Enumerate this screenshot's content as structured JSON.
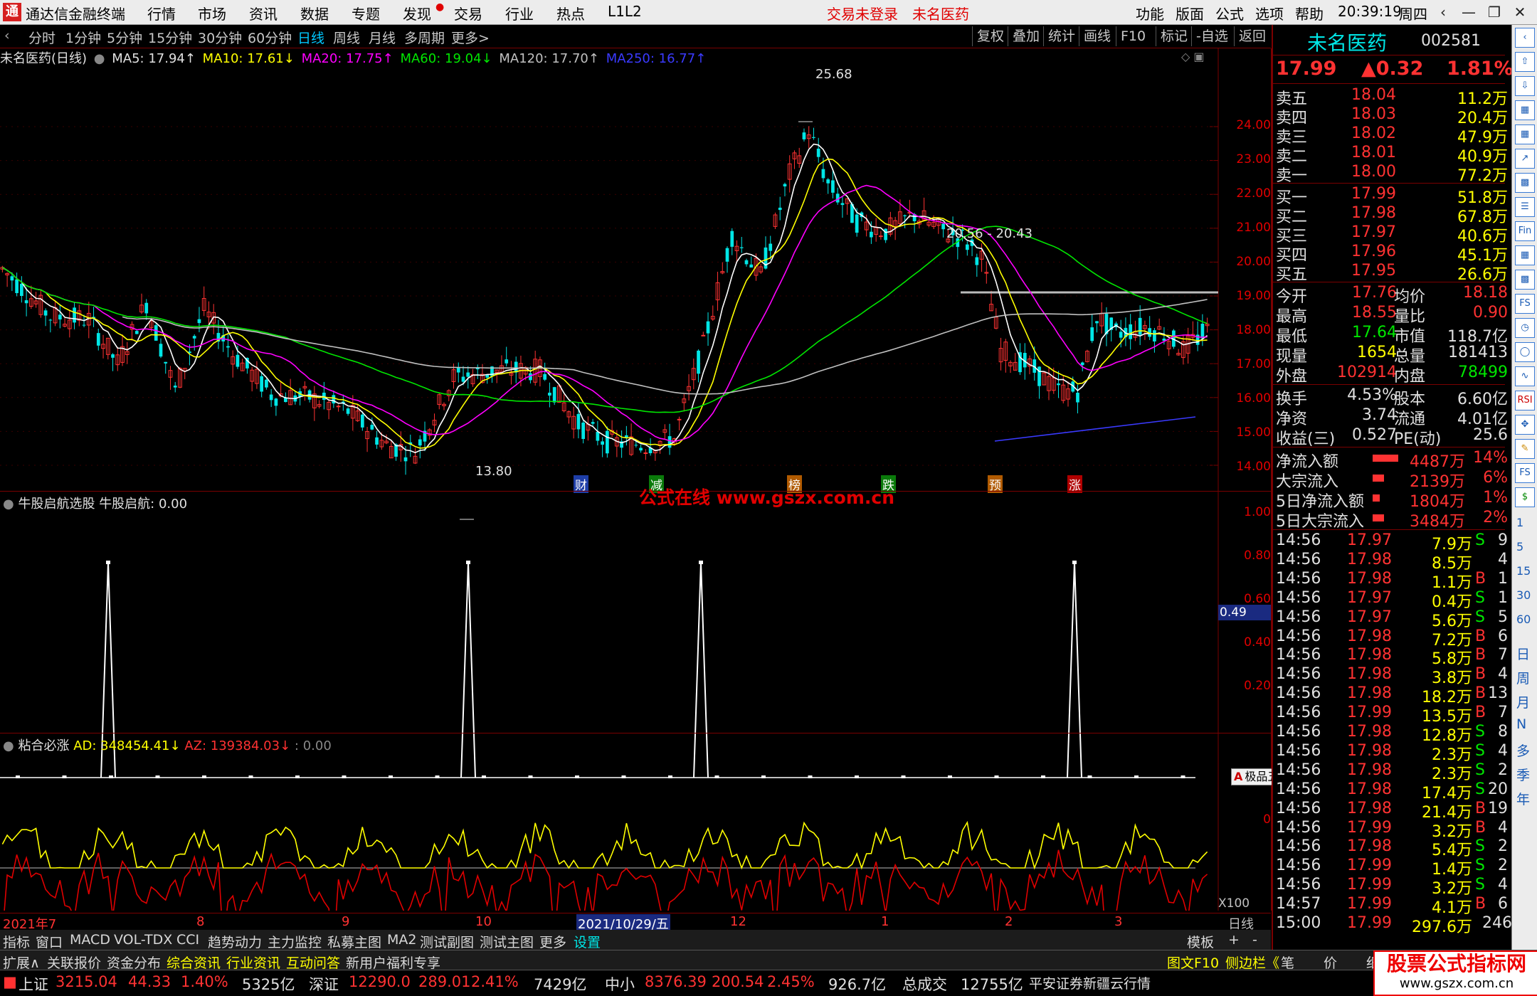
{
  "menu": {
    "app_title": "通达信金融终端",
    "items": [
      "行情",
      "市场",
      "资讯",
      "数据",
      "专题",
      "发现",
      "交易",
      "行业",
      "热点",
      "L1L2"
    ],
    "login_status": "交易未登录",
    "stock_name": "未名医药",
    "right_items": [
      "功能",
      "版面",
      "公式",
      "选项",
      "帮助"
    ],
    "time": "20:39:19",
    "weekday": "周四"
  },
  "periods": [
    "分时",
    "1分钟",
    "5分钟",
    "15分钟",
    "30分钟",
    "60分钟",
    "日线",
    "周线",
    "月线",
    "多周期",
    "更多>"
  ],
  "active_period": "日线",
  "tools": [
    "复权",
    "叠加",
    "统计",
    "画线",
    "F10",
    "标记",
    "-自选",
    "返回"
  ],
  "ma_bar": {
    "name": "未名医药(日线)",
    "ma5": "MA5: 17.94↑",
    "ma10": "MA10: 17.61↓",
    "ma20": "MA20: 17.75↑",
    "ma60": "MA60: 19.04↓",
    "ma120": "MA120: 17.70↑",
    "ma250": "MA250: 16.77↑"
  },
  "main_axis": [
    "24.00",
    "23.00",
    "22.00",
    "21.00",
    "20.00",
    "19.00",
    "18.00",
    "17.00",
    "16.00",
    "15.00",
    "14.00"
  ],
  "annotations": {
    "high": "25.68",
    "low": "13.80",
    "range": "20.56 - 20.43",
    "markers": [
      "财",
      "减",
      "榜",
      "跌",
      "预",
      "涨"
    ]
  },
  "indicator1": {
    "title": "牛股启航选股",
    "label": "牛股启航: 0.00",
    "axis": [
      "1.00",
      "0.80",
      "0.60",
      "0.40",
      "0.20"
    ],
    "cursor_value": "0.49",
    "watermark": "公式在线 www.gszx.com.cn"
  },
  "indicator2": {
    "title": "粘合必涨",
    "ad": "AD: 348454.41↓",
    "az": "AZ: 139384.03↓",
    "zero": ": 0.00",
    "axis_zero": "0",
    "scale": "X100"
  },
  "x_axis": [
    "2021年7",
    "8",
    "9",
    "10",
    "2021/10/29/五",
    "12",
    "1",
    "2",
    "3",
    "日线"
  ],
  "tabs1": [
    "指标",
    "窗口",
    "MACD",
    "VOL-TDX",
    "CCI",
    "趋势动力",
    "主力监控",
    "私募主图",
    "MA2",
    "测试副图",
    "测试主图",
    "更多",
    "设置",
    "模板",
    "+",
    "-"
  ],
  "tabs2": [
    "扩展∧",
    "关联报价",
    "资金分布",
    "综合资讯",
    "行业资讯",
    "互动问答",
    "新用户福利专享",
    "图文F10",
    "侧边栏《",
    "笔",
    "价",
    "细",
    "势"
  ],
  "status": {
    "sh_label": "上证",
    "sh_val": "3215.04",
    "sh_chg": "44.33",
    "sh_pct": "1.40%",
    "sh_amt": "5325亿",
    "sz_label": "深证",
    "sz_val": "12290.0",
    "sz_chg": "289.01",
    "sz_pct": "2.41%",
    "sz_amt": "7429亿",
    "zx_label": "中小",
    "zx_val": "8376.39",
    "zx_chg": "200.54",
    "zx_pct": "2.45%",
    "zx_amt": "926.7亿",
    "total_label": "总成交",
    "total_val": "12755亿",
    "broker": "平安证券新疆云行情",
    "brand": "股票公式指标网",
    "brand_url": "www.gszx.com.cn"
  },
  "quote": {
    "name": "未名医药",
    "code": "002581",
    "price": "17.99",
    "change": "▲0.32",
    "pct": "1.81%",
    "asks": [
      {
        "label": "卖五",
        "price": "18.04",
        "vol": "11.2万"
      },
      {
        "label": "卖四",
        "price": "18.03",
        "vol": "20.4万"
      },
      {
        "label": "卖三",
        "price": "18.02",
        "vol": "47.9万"
      },
      {
        "label": "卖二",
        "price": "18.01",
        "vol": "40.9万"
      },
      {
        "label": "卖一",
        "price": "18.00",
        "vol": "77.2万"
      }
    ],
    "bids": [
      {
        "label": "买一",
        "price": "17.99",
        "vol": "51.8万"
      },
      {
        "label": "买二",
        "price": "17.98",
        "vol": "67.8万"
      },
      {
        "label": "买三",
        "price": "17.97",
        "vol": "40.6万"
      },
      {
        "label": "买四",
        "price": "17.96",
        "vol": "45.1万"
      },
      {
        "label": "买五",
        "price": "17.95",
        "vol": "26.6万"
      }
    ],
    "stats": [
      [
        "今开",
        "17.76",
        "均价",
        "18.18"
      ],
      [
        "最高",
        "18.55",
        "量比",
        "0.90"
      ],
      [
        "最低",
        "17.64",
        "市值",
        "118.7亿"
      ],
      [
        "现量",
        "1654",
        "总量",
        "181413"
      ],
      [
        "外盘",
        "102914",
        "内盘",
        "78499"
      ]
    ],
    "stats2": [
      [
        "换手",
        "4.53%",
        "股本",
        "6.60亿"
      ],
      [
        "净资",
        "3.74",
        "流通",
        "4.01亿"
      ],
      [
        "收益(三)",
        "0.527",
        "PE(动)",
        "25.6"
      ]
    ],
    "flows": [
      [
        "净流入额",
        "4487万",
        "14%"
      ],
      [
        "大宗流入",
        "2139万",
        "6%"
      ],
      [
        "5日净流入额",
        "1804万",
        "1%"
      ],
      [
        "5日大宗流入",
        "3484万",
        "2%"
      ]
    ],
    "ticks": [
      [
        "14:56",
        "17.97",
        "7.9万",
        "S",
        "9"
      ],
      [
        "14:56",
        "17.98",
        "8.5万",
        "",
        "4"
      ],
      [
        "14:56",
        "17.98",
        "1.1万",
        "B",
        "1"
      ],
      [
        "14:56",
        "17.97",
        "0.4万",
        "S",
        "1"
      ],
      [
        "14:56",
        "17.97",
        "5.6万",
        "S",
        "5"
      ],
      [
        "14:56",
        "17.98",
        "7.2万",
        "B",
        "6"
      ],
      [
        "14:56",
        "17.98",
        "5.8万",
        "B",
        "7"
      ],
      [
        "14:56",
        "17.98",
        "3.8万",
        "B",
        "4"
      ],
      [
        "14:56",
        "17.98",
        "18.2万",
        "B",
        "13"
      ],
      [
        "14:56",
        "17.99",
        "13.5万",
        "B",
        "7"
      ],
      [
        "14:56",
        "17.98",
        "12.8万",
        "S",
        "8"
      ],
      [
        "14:56",
        "17.98",
        "2.3万",
        "S",
        "4"
      ],
      [
        "14:56",
        "17.98",
        "2.3万",
        "S",
        "2"
      ],
      [
        "14:56",
        "17.98",
        "17.4万",
        "S",
        "20"
      ],
      [
        "14:56",
        "17.98",
        "21.4万",
        "B",
        "19"
      ],
      [
        "14:56",
        "17.99",
        "3.2万",
        "B",
        "4"
      ],
      [
        "14:56",
        "17.98",
        "5.4万",
        "S",
        "2"
      ],
      [
        "14:56",
        "17.99",
        "1.4万",
        "S",
        "2"
      ],
      [
        "14:56",
        "17.99",
        "3.2万",
        "S",
        "4"
      ],
      [
        "14:57",
        "17.99",
        "4.1万",
        "B",
        "6"
      ],
      [
        "15:00",
        "17.99",
        "297.6万",
        "",
        "246"
      ]
    ]
  },
  "ime": "极品五笔",
  "sidebar_chars": [
    "日",
    "周",
    "月",
    "N",
    "多",
    "季",
    "年"
  ],
  "sidebar_nums": [
    "1",
    "5",
    "15",
    "30",
    "60"
  ],
  "colors": {
    "up": "#ff3232",
    "down": "#00e600",
    "frame": "#7a0000",
    "accent": "#00c8ff"
  }
}
